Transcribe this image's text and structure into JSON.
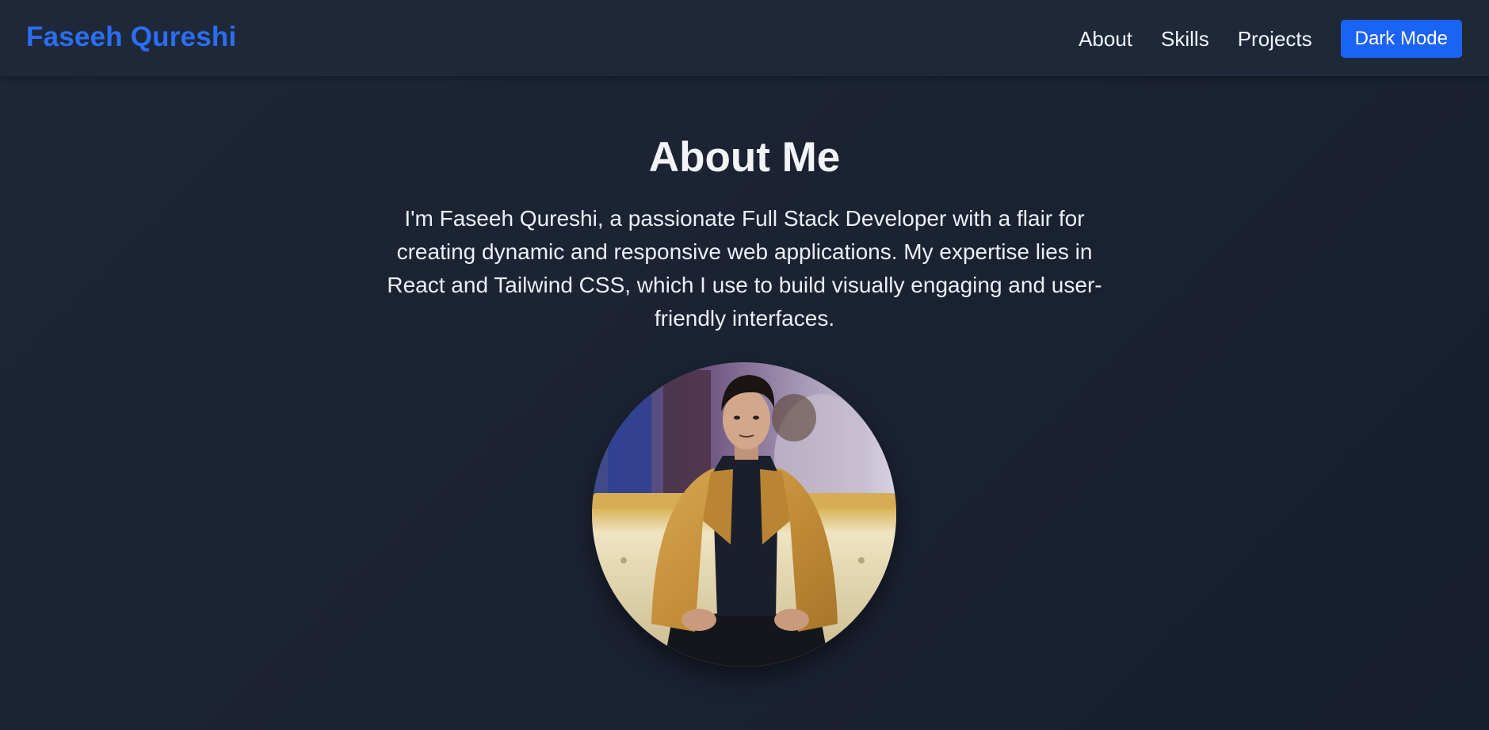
{
  "navbar": {
    "brand": "Faseeh Qureshi",
    "links": [
      {
        "label": "About"
      },
      {
        "label": "Skills"
      },
      {
        "label": "Projects"
      }
    ],
    "mode_button": "Dark Mode"
  },
  "about": {
    "title": "About Me",
    "paragraph": "I'm Faseeh Qureshi, a passionate Full Stack Developer with a flair for creating dynamic and responsive web applications. My expertise lies in React and Tailwind CSS, which I use to build visually engaging and user-friendly interfaces."
  },
  "colors": {
    "brand": "#2a6ff3",
    "button": "#1b63f5",
    "background": "#1b2232",
    "navbar": "#1f2839"
  }
}
